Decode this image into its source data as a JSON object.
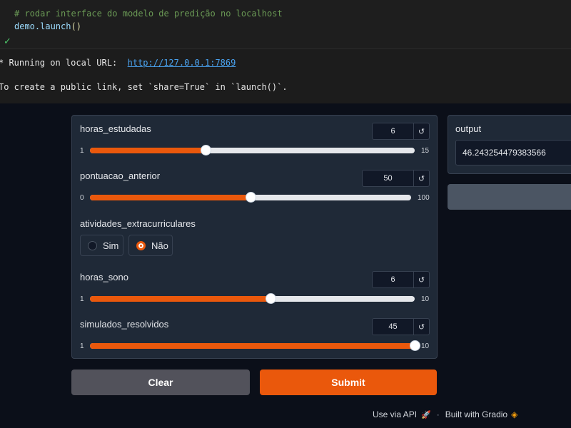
{
  "notebook": {
    "code_comment": "# rodar interface do modelo de predição no localhost",
    "code_call": "demo.launch",
    "code_parens": "()",
    "run_status_icon": "check-icon",
    "output_url_prefix": "* Running on local URL:  ",
    "output_url": "http://127.0.0.1:7869",
    "output_share_note": "To create a public link, set `share=True` in `launch()`."
  },
  "inputs": {
    "horas_estudadas": {
      "label": "horas_estudadas",
      "value": "6",
      "min": "1",
      "max": "15",
      "level": 0.357
    },
    "pontuacao_anterior": {
      "label": "pontuacao_anterior",
      "value": "50",
      "min": "0",
      "max": "100",
      "level": 0.5
    },
    "atividades_extracurriculares": {
      "label": "atividades_extracurriculares",
      "options": [
        "Sim",
        "Não"
      ],
      "selected": "Não"
    },
    "horas_sono": {
      "label": "horas_sono",
      "value": "6",
      "min": "1",
      "max": "10",
      "level": 0.556
    },
    "simulados_resolvidos": {
      "label": "simulados_resolvidos",
      "value": "45",
      "min": "1",
      "max": "10",
      "level": 1.0
    },
    "reset_icon": "↺"
  },
  "output": {
    "label": "output",
    "value": "46.243254479383566"
  },
  "buttons": {
    "clear": "Clear",
    "submit": "Submit"
  },
  "footer": {
    "api": "Use via API",
    "separator": "·",
    "built_with": "Built with Gradio"
  },
  "colors": {
    "accent": "#ea580c",
    "background": "#0b0f19",
    "panel": "#1f2937"
  }
}
